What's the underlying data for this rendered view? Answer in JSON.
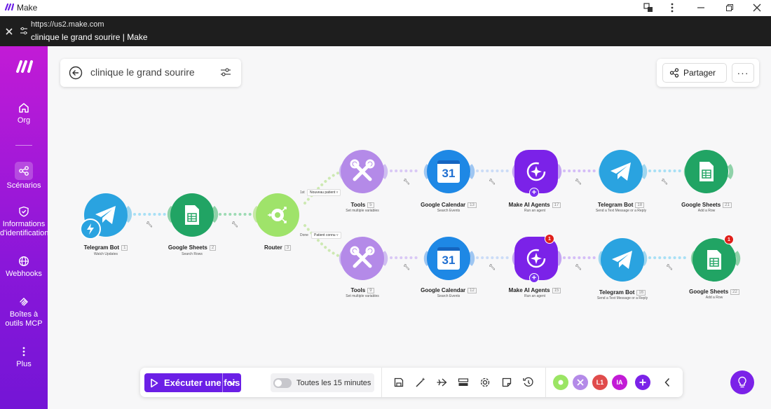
{
  "window": {
    "app_title": "Make",
    "url": "https://us2.make.com",
    "page_title": "clinique le grand sourire | Make"
  },
  "sidebar": {
    "items": [
      {
        "label": "Org",
        "icon": "home-icon"
      },
      {
        "label": "Scénarios",
        "icon": "share-nodes-icon"
      },
      {
        "label": "Informations d'identification",
        "icon": "shield-check-icon"
      },
      {
        "label": "Webhooks",
        "icon": "globe-icon"
      },
      {
        "label": "Boîtes à outils MCP",
        "icon": "mcp-icon"
      },
      {
        "label": "Plus",
        "icon": "more-vertical-icon"
      }
    ]
  },
  "scenario": {
    "name": "clinique le grand sourire"
  },
  "header": {
    "share_label": "Partager",
    "more_label": "···"
  },
  "modules": {
    "telegram_trigger": {
      "name": "Telegram Bot",
      "num": "1",
      "sub": "Watch Updates"
    },
    "sheets_search": {
      "name": "Google Sheets",
      "num": "2",
      "sub": "Search Rows"
    },
    "router": {
      "name": "Router",
      "num": "3"
    },
    "top": {
      "tools": {
        "name": "Tools",
        "num": "5",
        "sub": "Set multiple variables"
      },
      "calendar": {
        "name": "Google Calendar",
        "num": "13",
        "sub": "Search Events",
        "day": "31"
      },
      "agent": {
        "name": "Make AI Agents",
        "num": "17",
        "sub": "Run an agent"
      },
      "telegram": {
        "name": "Telegram Bot",
        "num": "18",
        "sub": "Send a Text Message or a Reply"
      },
      "sheets": {
        "name": "Google Sheets",
        "num": "21",
        "sub": "Add a Row"
      }
    },
    "bottom": {
      "tools": {
        "name": "Tools",
        "num": "9",
        "sub": "Set multiple variables"
      },
      "calendar": {
        "name": "Google Calendar",
        "num": "12",
        "sub": "Search Events",
        "day": "31"
      },
      "agent": {
        "name": "Make AI Agents",
        "num": "15",
        "sub": "Run an agent",
        "badge": "1"
      },
      "telegram": {
        "name": "Telegram Bot",
        "num": "16",
        "sub": "Send a Text Message or a Reply"
      },
      "sheets": {
        "name": "Google Sheets",
        "num": "22",
        "sub": "Add a Row",
        "badge": "1"
      }
    },
    "routes": {
      "top_pre": "1st",
      "top_label": "Nouveau patient",
      "bottom_pre": "Done",
      "bottom_label": "Patient connu"
    }
  },
  "toolbar": {
    "run_label": "Exécuter une fois",
    "schedule_label": "Toutes les 15 minutes",
    "schedule_on": false,
    "mini_badges": [
      {
        "label": "",
        "color": "#9be564"
      },
      {
        "label": "",
        "color": "#b48ae8"
      },
      {
        "label": "L1",
        "color": "#e04c4c"
      },
      {
        "label": "IA",
        "color": "#c21bd6"
      }
    ]
  },
  "colors": {
    "brand_purple": "#6b1fe6",
    "telegram_blue": "#2aa3e0",
    "sheets_green": "#21a464",
    "router_green": "#9fe36a",
    "tools_purple": "#b48ae8",
    "calendar_blue": "#1e88e5",
    "agent_purple": "#7b22e8"
  }
}
